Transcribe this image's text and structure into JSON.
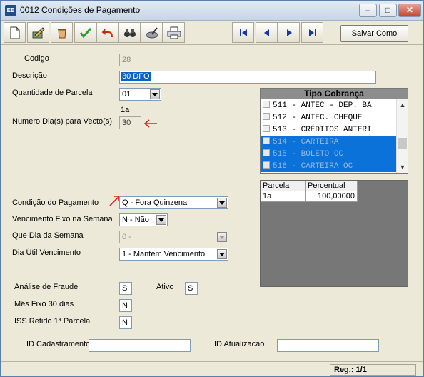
{
  "window": {
    "title": "0012 Condições de Pagamento",
    "icon_text": "EE"
  },
  "toolbar": {
    "salvar_label": "Salvar Como"
  },
  "form": {
    "codigo_label": "Codigo",
    "codigo_value": "28",
    "descricao_label": "Descrição",
    "descricao_value": "30 DFO",
    "qtd_parcela_label": "Quantidade de Parcela",
    "qtd_parcela_value": "01",
    "parcela_hint": "1a",
    "dias_vecto_label": "Numero Dia(s) para Vecto(s)",
    "dias_vecto_value": "30",
    "condicao_label": "Condição do Pagamento",
    "condicao_value": "Q - Fora Quinzena",
    "venc_fixo_label": "Vencimento Fixo na Semana",
    "venc_fixo_value": "N - Não",
    "dia_semana_label": "Que Dia da Semana",
    "dia_semana_value": "0 -",
    "dia_util_label": "Dia Útil Vencimento",
    "dia_util_value": "1 - Mantém Vencimento",
    "fraude_label": "Análise de Fraude",
    "fraude_value": "S",
    "ativo_label": "Ativo",
    "ativo_value": "S",
    "mes_fixo_label": "Mês Fixo 30 dias",
    "mes_fixo_value": "N",
    "iss_label": "ISS Retido 1ª Parcela",
    "iss_value": "N",
    "id_cad_label": "ID Cadastramento",
    "id_cad_value": "",
    "id_atu_label": "ID Atualizacao",
    "id_atu_value": ""
  },
  "tipo_cobranca": {
    "title": "Tipo Cobrança",
    "items": [
      {
        "label": "511 - ANTEC - DEP. BA",
        "checked": false
      },
      {
        "label": "512 - ANTEC. CHEQUE",
        "checked": false
      },
      {
        "label": "513 - CRÉDITOS ANTERI",
        "checked": false
      },
      {
        "label": "514 - CARTEIRA",
        "checked": true
      },
      {
        "label": "515 - BOLETO OC",
        "checked": true
      },
      {
        "label": "516 - CARTEIRA OC",
        "checked": true
      }
    ]
  },
  "parcelas": {
    "headers": [
      "Parcela",
      "Percentual"
    ],
    "rows": [
      [
        "1a",
        "100,00000"
      ]
    ]
  },
  "status": {
    "reg": "Reg.: 1/1"
  },
  "colors": {
    "selection": "#0a72d8",
    "annotation_arrow": "#e02020"
  }
}
